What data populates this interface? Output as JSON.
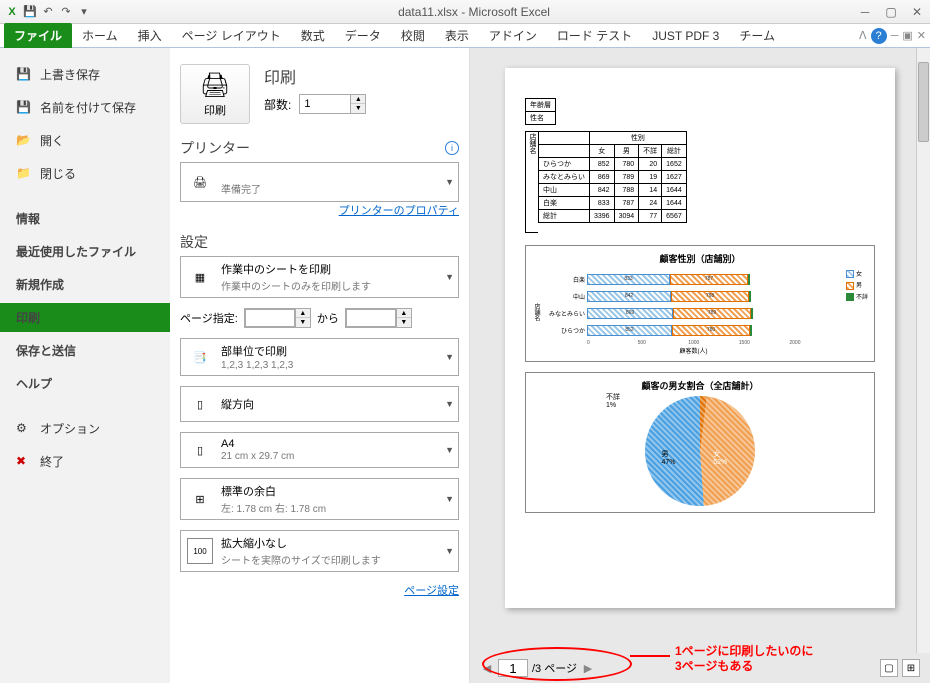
{
  "window": {
    "title": "data11.xlsx - Microsoft Excel"
  },
  "ribbon": {
    "file": "ファイル",
    "tabs": [
      "ホーム",
      "挿入",
      "ページ レイアウト",
      "数式",
      "データ",
      "校閲",
      "表示",
      "アドイン",
      "ロード テスト",
      "JUST PDF 3",
      "チーム"
    ]
  },
  "sidebar": {
    "save": "上書き保存",
    "saveas": "名前を付けて保存",
    "open": "開く",
    "close": "閉じる",
    "info": "情報",
    "recent": "最近使用したファイル",
    "new": "新規作成",
    "print": "印刷",
    "share": "保存と送信",
    "help": "ヘルプ",
    "options": "オプション",
    "exit": "終了"
  },
  "print": {
    "title": "印刷",
    "btn_label": "印刷",
    "copies_label": "部数:",
    "copies_value": "1",
    "printer_heading": "プリンター",
    "printer_status": "準備完了",
    "printer_props": "プリンターのプロパティ",
    "settings_heading": "設定",
    "scope_main": "作業中のシートを印刷",
    "scope_sub": "作業中のシートのみを印刷します",
    "range_label": "ページ指定:",
    "range_to": "から",
    "collate_main": "部単位で印刷",
    "collate_sub": "1,2,3    1,2,3    1,2,3",
    "orient": "縦方向",
    "paper_main": "A4",
    "paper_sub": "21 cm x 29.7 cm",
    "margin_main": "標準の余白",
    "margin_sub": "左: 1.78 cm   右: 1.78 cm",
    "scale_main": "拡大縮小なし",
    "scale_sub": "シートを実際のサイズで印刷します",
    "page_setup": "ページ設定"
  },
  "preview": {
    "page_current": "1",
    "page_total": "/3 ページ",
    "small_table_r1": "年齢層",
    "small_table_r2": "性名",
    "table_group_header": "性別",
    "table_headers": [
      "",
      "女",
      "男",
      "不詳",
      "総計"
    ],
    "table_side_label": "店舗名",
    "table_rows": [
      [
        "ひらつか",
        "852",
        "780",
        "20",
        "1652"
      ],
      [
        "みなとみらい",
        "869",
        "789",
        "19",
        "1627"
      ],
      [
        "中山",
        "842",
        "788",
        "14",
        "1644"
      ],
      [
        "白楽",
        "833",
        "787",
        "24",
        "1644"
      ],
      [
        "総計",
        "3396",
        "3094",
        "77",
        "6567"
      ]
    ],
    "chart1_title": "顧客性別（店舗別）",
    "chart1_ylabel": "店舗名",
    "chart1_xlabel": "顧客数(人)",
    "chart1_legend": [
      "女",
      "男",
      "不詳"
    ],
    "chart1_ticks": [
      "0",
      "500",
      "1000",
      "1500",
      "2000"
    ],
    "chart2_title": "顧客の男女割合（全店舗計）",
    "pie_female": "女\n52%",
    "pie_male": "男\n47%",
    "pie_unknown": "不詳\n1%"
  },
  "annotation": {
    "text": "1ページに印刷したいのに\n3ページもある"
  },
  "chart_data": [
    {
      "type": "bar",
      "orientation": "horizontal-stacked",
      "title": "顧客性別（店舗別）",
      "categories": [
        "白楽",
        "中山",
        "みなとみらい",
        "ひらつか"
      ],
      "series": [
        {
          "name": "女",
          "values": [
            833,
            842,
            869,
            852
          ]
        },
        {
          "name": "男",
          "values": [
            787,
            788,
            789,
            780
          ]
        },
        {
          "name": "不詳",
          "values": [
            24,
            14,
            19,
            20
          ]
        }
      ],
      "xlabel": "顧客数(人)",
      "ylabel": "店舗名",
      "xlim": [
        0,
        2000
      ]
    },
    {
      "type": "pie",
      "title": "顧客の男女割合（全店舗計）",
      "categories": [
        "女",
        "男",
        "不詳"
      ],
      "values": [
        52,
        47,
        1
      ]
    }
  ]
}
